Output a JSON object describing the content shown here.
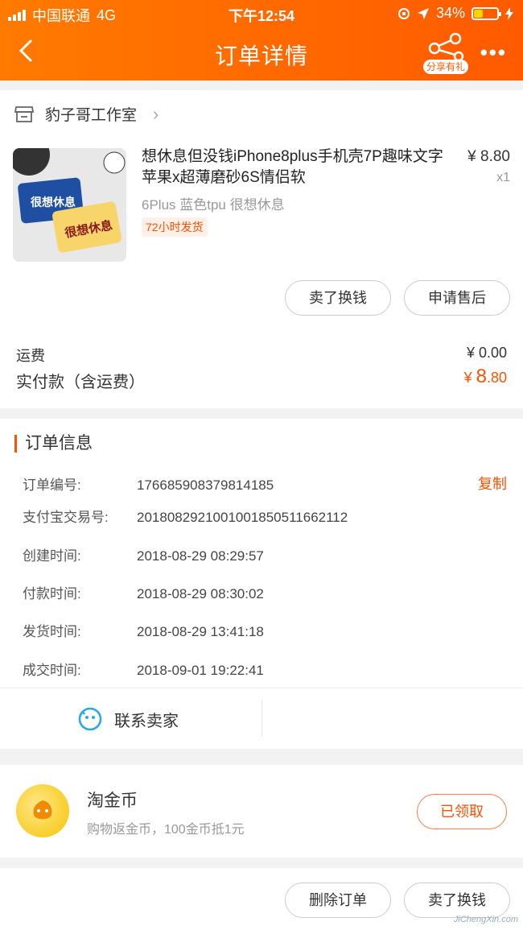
{
  "status_bar": {
    "carrier": "中国联通",
    "network": "4G",
    "time": "下午12:54",
    "battery": "34%"
  },
  "nav": {
    "title": "订单详情",
    "share_label": "分享有礼"
  },
  "shop": {
    "name": "豹子哥工作室"
  },
  "product": {
    "title": "想休息但没钱iPhone8plus手机壳7P趣味文字苹果x超薄磨砂6S情侣软",
    "price": "¥ 8.80",
    "qty": "x1",
    "sku": "6Plus 蓝色tpu 很想休息",
    "tag": "72小时发货",
    "thumb_text_1": "很想休息",
    "thumb_text_2": "很想休息"
  },
  "item_buttons": {
    "sell": "卖了换钱",
    "after_sale": "申请售后"
  },
  "fees": {
    "shipping_label": "运费",
    "shipping_value": "¥ 0.00",
    "paid_label": "实付款（含运费）",
    "paid_currency": "¥ ",
    "paid_int": "8",
    "paid_dec": ".80"
  },
  "order_info": {
    "title": "订单信息",
    "copy_label": "复制",
    "rows": [
      {
        "k": "订单编号:",
        "v": "176685908379814185"
      },
      {
        "k": "支付宝交易号:",
        "v": "2018082921001001850511662112"
      },
      {
        "k": "创建时间:",
        "v": "2018-08-29 08:29:57"
      },
      {
        "k": "付款时间:",
        "v": "2018-08-29 08:30:02"
      },
      {
        "k": "发货时间:",
        "v": "2018-08-29 13:41:18"
      },
      {
        "k": "成交时间:",
        "v": "2018-09-01 19:22:41"
      }
    ],
    "contact": "联系卖家"
  },
  "coin": {
    "title": "淘金币",
    "subtitle": "购物返金币，100金币抵1元",
    "button": "已领取"
  },
  "bottom": {
    "delete": "删除订单",
    "sell": "卖了换钱",
    "watermark": "JiChengXin.com"
  },
  "colors": {
    "accent": "#ff5000",
    "header_start": "#ff7a00",
    "header_end": "#ff5a00"
  }
}
